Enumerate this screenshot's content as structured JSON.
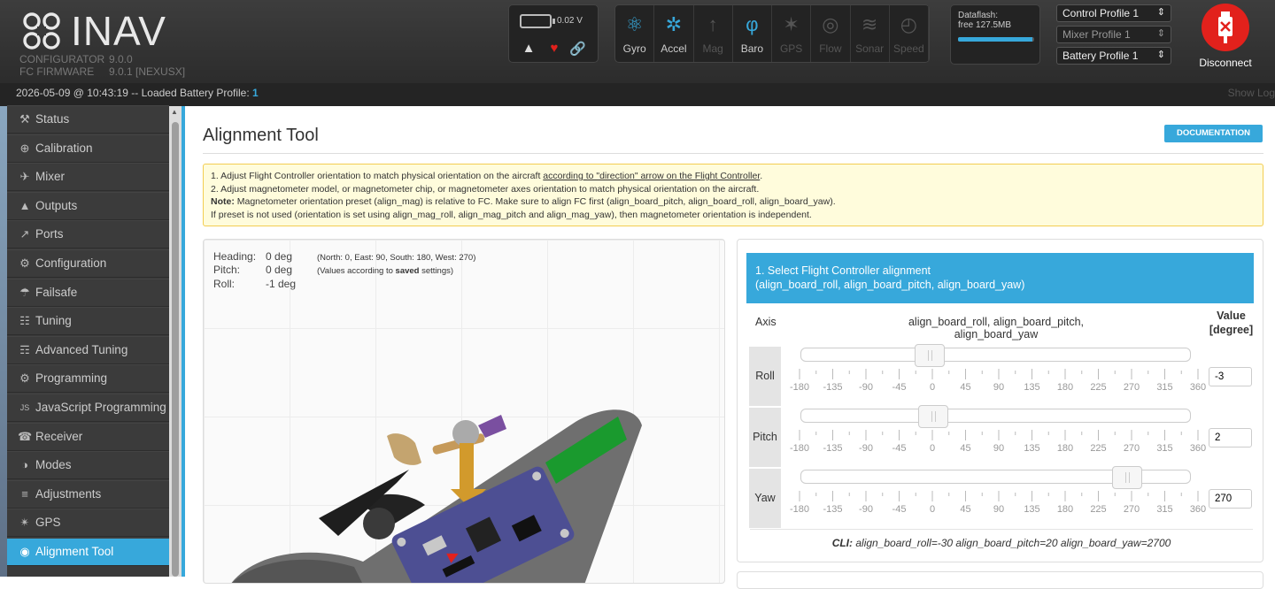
{
  "header": {
    "brand": "INAV",
    "configurator_label": "CONFIGURATOR",
    "configurator_version": "9.0.0",
    "firmware_label": "FC FIRMWARE",
    "firmware_version": "9.0.1 [NEXUSX]",
    "battery_voltage": "0.02 V",
    "sensors": [
      {
        "label": "Gyro",
        "icon": "gyro-icon",
        "active": true
      },
      {
        "label": "Accel",
        "icon": "accel-icon",
        "active": true
      },
      {
        "label": "Mag",
        "icon": "mag-icon",
        "active": false
      },
      {
        "label": "Baro",
        "icon": "baro-icon",
        "active": true
      },
      {
        "label": "GPS",
        "icon": "gps-icon",
        "active": false
      },
      {
        "label": "Flow",
        "icon": "flow-icon",
        "active": false
      },
      {
        "label": "Sonar",
        "icon": "sonar-icon",
        "active": false
      },
      {
        "label": "Speed",
        "icon": "speed-icon",
        "active": false
      }
    ],
    "dataflash_label": "Dataflash:",
    "dataflash_free": "free 127.5MB",
    "dataflash_used_fraction": 0.98,
    "control_profile": "Control Profile 1",
    "mixer_profile": "Mixer Profile 1",
    "battery_profile": "Battery Profile 1",
    "disconnect_label": "Disconnect",
    "accent_color": "#37a8db",
    "disconnect_color": "#e2211c"
  },
  "statusbar": {
    "message": "2026-05-09 @ 10:43:19 -- Loaded Battery Profile: ",
    "profile_number": "1",
    "show_log": "Show Log"
  },
  "sidebar": {
    "items": [
      {
        "label": "Status",
        "icon": "wrench-icon",
        "active": false
      },
      {
        "label": "Calibration",
        "icon": "crosshair-icon",
        "active": false
      },
      {
        "label": "Mixer",
        "icon": "mixer-icon",
        "active": false
      },
      {
        "label": "Outputs",
        "icon": "motor-icon",
        "active": false
      },
      {
        "label": "Ports",
        "icon": "plug-icon",
        "active": false
      },
      {
        "label": "Configuration",
        "icon": "gear-icon",
        "active": false
      },
      {
        "label": "Failsafe",
        "icon": "parachute-icon",
        "active": false
      },
      {
        "label": "Tuning",
        "icon": "tuning-icon",
        "active": false
      },
      {
        "label": "Advanced Tuning",
        "icon": "advanced-tuning-icon",
        "active": false
      },
      {
        "label": "Programming",
        "icon": "cog-icon",
        "active": false
      },
      {
        "label": "JavaScript Programming",
        "icon": "js-icon",
        "active": false
      },
      {
        "label": "Receiver",
        "icon": "receiver-icon",
        "active": false
      },
      {
        "label": "Modes",
        "icon": "toggle-icon",
        "active": false
      },
      {
        "label": "Adjustments",
        "icon": "sliders-icon",
        "active": false
      },
      {
        "label": "GPS",
        "icon": "satellite-icon",
        "active": false
      },
      {
        "label": "Alignment Tool",
        "icon": "compass-icon",
        "active": true
      }
    ]
  },
  "main": {
    "title": "Alignment Tool",
    "doc_button": "DOCUMENTATION",
    "note": {
      "line1_pre": "1. Adjust Flight Controller orientation to match physical orientation on the aircraft ",
      "line1_link": "according to \"direction\" arrow on the Flight Controller",
      "line1_post": ".",
      "line2": "2. Adjust magnetometer model, or magnetometer chip, or magnetometer axes orientation to match physical orientation on the aircraft.",
      "line3_label": "Note:",
      "line3": " Magnetometer orientation preset (align_mag) is relative to FC. Make sure to align FC first (align_board_pitch, align_board_roll, align_board_yaw).",
      "line4": "If preset is not used (orientation is set using align_mag_roll, align_mag_pitch and align_mag_yaw), then magnetometer orientation is independent."
    },
    "attitude": {
      "heading_label": "Heading:",
      "heading_value": "0 deg",
      "pitch_label": "Pitch:",
      "pitch_value": "0 deg",
      "roll_label": "Roll:",
      "roll_value": "-1 deg",
      "hint1": "(North: 0, East: 90, South: 180, West: 270)",
      "hint2_pre": "(Values according to ",
      "hint2_bold": "saved",
      "hint2_post": " settings)"
    },
    "panel": {
      "heading_line1": "1. Select Flight Controller alignment",
      "heading_line2": "(align_board_roll, align_board_pitch, align_board_yaw)",
      "axis_header": "Axis",
      "mid_header": "align_board_roll, align_board_pitch, align_board_yaw",
      "value_header_1": "Value",
      "value_header_2": "[degree]",
      "tick_labels": [
        "-180",
        "-135",
        "-90",
        "-45",
        "0",
        "45",
        "90",
        "135",
        "180",
        "225",
        "270",
        "315",
        "360"
      ],
      "slider_min": -180,
      "slider_max": 360,
      "rows": [
        {
          "axis": "Roll",
          "value": "-3",
          "slider_value": -3
        },
        {
          "axis": "Pitch",
          "value": "2",
          "slider_value": 2
        },
        {
          "axis": "Yaw",
          "value": "270",
          "slider_value": 270
        }
      ],
      "cli_label": "CLI:",
      "cli_text": " align_board_roll=-30 align_board_pitch=20 align_board_yaw=2700"
    }
  }
}
